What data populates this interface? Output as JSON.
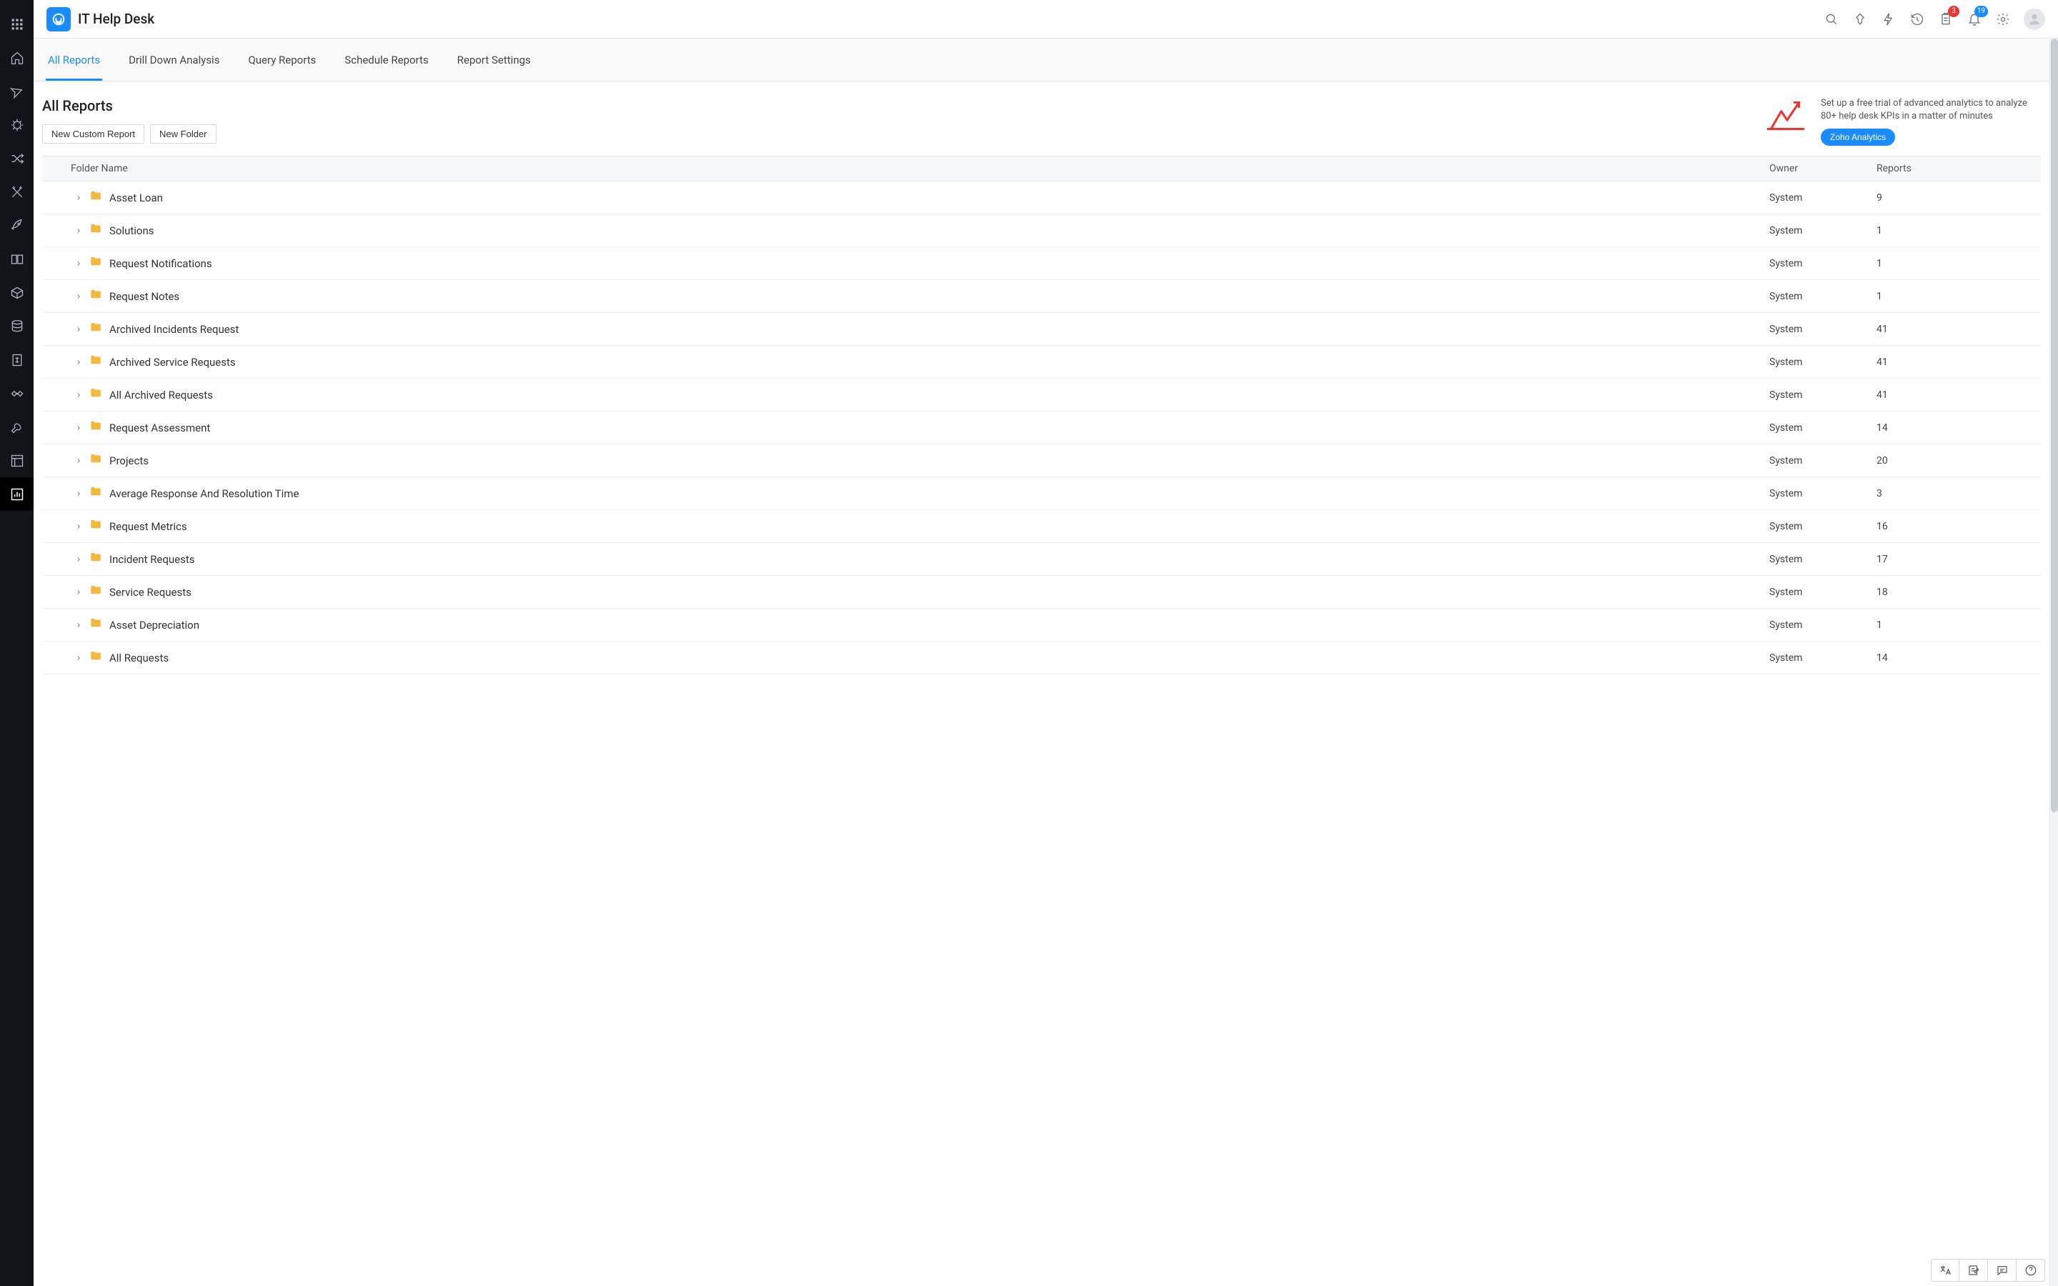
{
  "app": {
    "title": "IT Help Desk"
  },
  "header": {
    "badge1": "3",
    "badge2": "19"
  },
  "tabs": [
    {
      "label": "All Reports",
      "active": true
    },
    {
      "label": "Drill Down Analysis",
      "active": false
    },
    {
      "label": "Query Reports",
      "active": false
    },
    {
      "label": "Schedule Reports",
      "active": false
    },
    {
      "label": "Report Settings",
      "active": false
    }
  ],
  "page": {
    "title": "All Reports",
    "new_custom_report": "New Custom Report",
    "new_folder": "New Folder"
  },
  "promo": {
    "text": "Set up a free trial of advanced analytics to analyze 80+ help desk KPIs in a matter of minutes",
    "button": "Zoho Analytics"
  },
  "columns": {
    "folder": "Folder Name",
    "owner": "Owner",
    "reports": "Reports"
  },
  "folders": [
    {
      "name": "Asset Loan",
      "owner": "System",
      "reports": "9"
    },
    {
      "name": "Solutions",
      "owner": "System",
      "reports": "1"
    },
    {
      "name": "Request Notifications",
      "owner": "System",
      "reports": "1"
    },
    {
      "name": "Request Notes",
      "owner": "System",
      "reports": "1"
    },
    {
      "name": "Archived Incidents Request",
      "owner": "System",
      "reports": "41"
    },
    {
      "name": "Archived Service Requests",
      "owner": "System",
      "reports": "41"
    },
    {
      "name": "All Archived Requests",
      "owner": "System",
      "reports": "41"
    },
    {
      "name": "Request Assessment",
      "owner": "System",
      "reports": "14"
    },
    {
      "name": "Projects",
      "owner": "System",
      "reports": "20"
    },
    {
      "name": "Average Response And Resolution Time",
      "owner": "System",
      "reports": "3"
    },
    {
      "name": "Request Metrics",
      "owner": "System",
      "reports": "16"
    },
    {
      "name": "Incident Requests",
      "owner": "System",
      "reports": "17"
    },
    {
      "name": "Service Requests",
      "owner": "System",
      "reports": "18"
    },
    {
      "name": "Asset Depreciation",
      "owner": "System",
      "reports": "1"
    },
    {
      "name": "All Requests",
      "owner": "System",
      "reports": "14"
    }
  ]
}
